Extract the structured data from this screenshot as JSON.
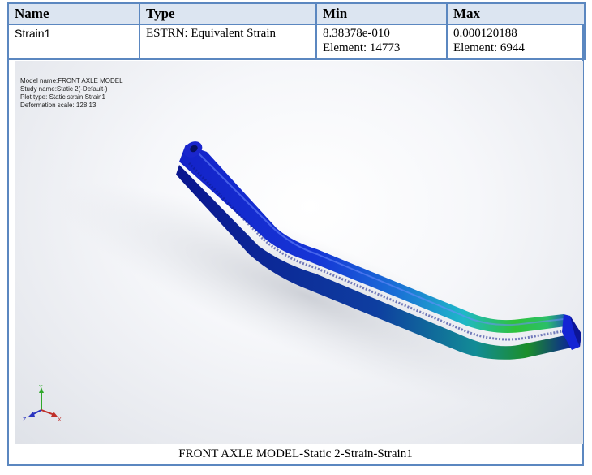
{
  "table": {
    "headers": {
      "name": "Name",
      "type": "Type",
      "min": "Min",
      "max": "Max"
    },
    "row": {
      "name": "Strain1",
      "type": "ESTRN: Equivalent Strain",
      "min_value": "8.38378e-010",
      "min_element": "Element: 14773",
      "max_value": "0.000120188",
      "max_element": "Element: 6944"
    }
  },
  "plot": {
    "info": {
      "model_name": "Model name:FRONT AXLE MODEL",
      "study_name": "Study name:Static 2(-Default-)",
      "plot_type": "Plot type: Static strain Strain1",
      "deformation_scale": "Deformation scale: 128.13"
    },
    "triad": {
      "x": "X",
      "y": "Y",
      "z": "Z"
    },
    "colors": {
      "low": "#1a2fd0",
      "mid": "#1fb7c9",
      "high": "#2ec428"
    }
  },
  "caption": "FRONT AXLE MODEL-Static 2-Strain-Strain1"
}
